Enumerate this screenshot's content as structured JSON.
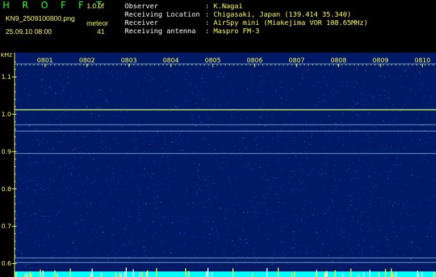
{
  "header": {
    "title": "H R O F F T",
    "version": "1.0.0f",
    "filename": "KN9_2509100800.png",
    "datetime": "25.09.10 08:00",
    "counter_label": "meteor",
    "counter_value": "41"
  },
  "meta": [
    {
      "label": "Observer",
      "value": ": K.Nagai"
    },
    {
      "label": "Receiving Location",
      "value": ": Chigasaki, Japan (139.414 35.340)"
    },
    {
      "label": "Receiver",
      "value": ": AirSpy mini (Miakejima VOR 108.65MHz)"
    },
    {
      "label": "Receiving antenna",
      "value": ": Maspro FM-3"
    }
  ],
  "chart_data": {
    "type": "heatmap",
    "ylabel": "kHz",
    "y_ticks": [
      "1.1",
      "1.0",
      "0.9",
      "0.8",
      "0.7",
      "0.6"
    ],
    "ylim": [
      0.59,
      1.165
    ],
    "x_ticks": [
      "0801",
      "0802",
      "0803",
      "0804",
      "0805",
      "0806",
      "0807",
      "0808",
      "0809",
      "0810"
    ],
    "signal_lines_khz": [
      1.135,
      1.012,
      0.972,
      0.955,
      0.895,
      0.615,
      0.603
    ],
    "colors": {
      "background": "#001a66",
      "noise": "#3366ff",
      "line": "#aaddff",
      "strong_line": "#ccff66",
      "axis": "#ffff66",
      "bottom_band": "#00ffff"
    }
  }
}
